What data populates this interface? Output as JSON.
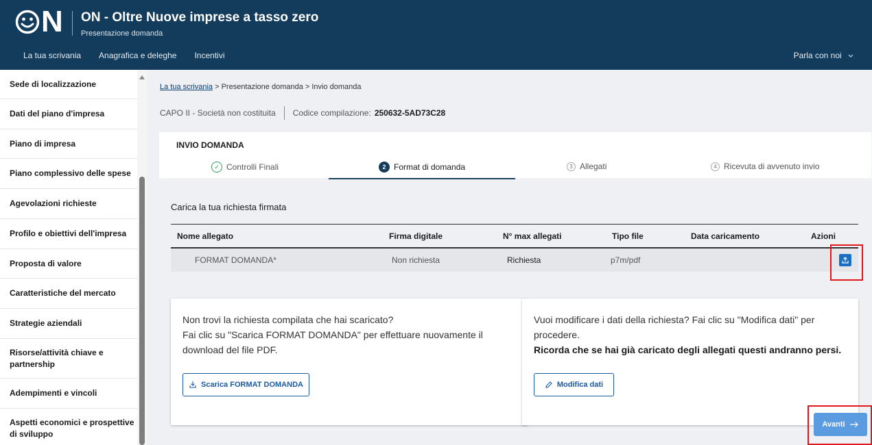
{
  "header": {
    "logo_text": "N",
    "title": "ON - Oltre Nuove imprese a tasso zero",
    "subtitle": "Presentazione domanda",
    "nav": [
      "La tua scrivania",
      "Anagrafica e deleghe",
      "Incentivi"
    ],
    "help": "Parla con noi",
    "bg_color": "#123b5c"
  },
  "sidebar": {
    "items": [
      "Sede di localizzazione",
      "Dati del piano d'impresa",
      "Piano di impresa",
      "Piano complessivo delle spese",
      "Agevolazioni richieste",
      "Profilo e obiettivi dell'impresa",
      "Proposta di valore",
      "Caratteristiche del mercato",
      "Strategie aziendali",
      "Risorse/attività chiave e partnership",
      "Adempimenti e vincoli",
      "Aspetti economici e prospettive di sviluppo"
    ]
  },
  "breadcrumb": {
    "link": "La tua scrivania",
    "rest": " > Presentazione domanda > Invio domanda"
  },
  "meta": {
    "capo": "CAPO II - Società non costituita",
    "codice_label": "Codice compilazione:",
    "codice_value": "250632-5AD73C28"
  },
  "card": {
    "title": "INVIO DOMANDA",
    "steps": [
      {
        "num": "✓",
        "label": "Controlli Finali"
      },
      {
        "num": "2",
        "label": "Format di domanda"
      },
      {
        "num": "3",
        "label": "Allegati"
      },
      {
        "num": "4",
        "label": "Ricevuta di avvenuto invio"
      }
    ],
    "section_title": "Carica la tua richiesta firmata"
  },
  "table": {
    "headers": [
      "Nome allegato",
      "Firma digitale",
      "N° max allegati",
      "Tipo file",
      "Data caricamento",
      "Azioni"
    ],
    "row": {
      "nome": "FORMAT DOMANDA*",
      "firma": "Non richiesta",
      "max": "Richiesta",
      "tipo": "p7m/pdf",
      "data": ""
    }
  },
  "panel_left": {
    "line1": "Non trovi la richiesta compilata che hai scaricato?",
    "line2": "Fai clic su \"Scarica FORMAT DOMANDA\" per effettuare nuovamente il download del file PDF.",
    "button": "Scarica FORMAT DOMANDA"
  },
  "panel_right": {
    "line1": "Vuoi modificare i dati della richiesta? Fai clic su \"Modifica dati\" per procedere.",
    "line2": "Ricorda che se hai già caricato degli allegati questi andranno persi.",
    "button": "Modifica dati"
  },
  "footer": {
    "next_button": "Avanti"
  },
  "colors": {
    "highlight": "#e0161b",
    "primary_button": "#5b9be0",
    "upload_button": "#1a6fc2"
  }
}
